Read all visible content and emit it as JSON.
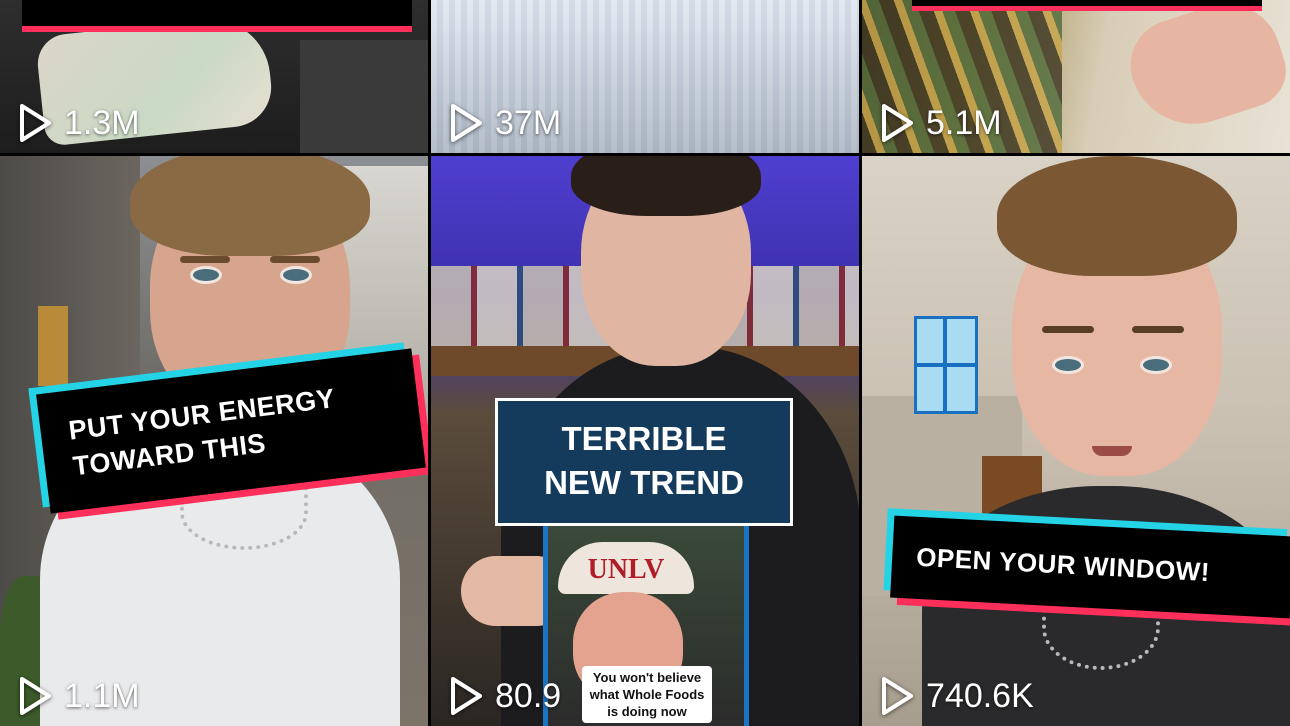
{
  "tiles": [
    {
      "views": "1.3M",
      "caption": []
    },
    {
      "views": "37M",
      "caption": []
    },
    {
      "views": "5.1M",
      "caption": []
    },
    {
      "views": "1.1M",
      "caption": [
        "PUT YOUR ENERGY",
        "TOWARD THIS"
      ]
    },
    {
      "views": "80.9",
      "caption": [
        "TERRIBLE",
        "NEW TREND"
      ],
      "inset": {
        "hat_text": "UNLV",
        "subtitle": [
          "You won't believe",
          "what Whole Foods",
          "is doing now"
        ]
      }
    },
    {
      "views": "740.6K",
      "caption": [
        "OPEN YOUR WINDOW!"
      ]
    }
  ],
  "colors": {
    "sticker_cyan": "#25d3e6",
    "sticker_pink": "#ff2f5b",
    "trend_banner": "#143a5c"
  },
  "icons": {
    "views": "play-icon"
  }
}
